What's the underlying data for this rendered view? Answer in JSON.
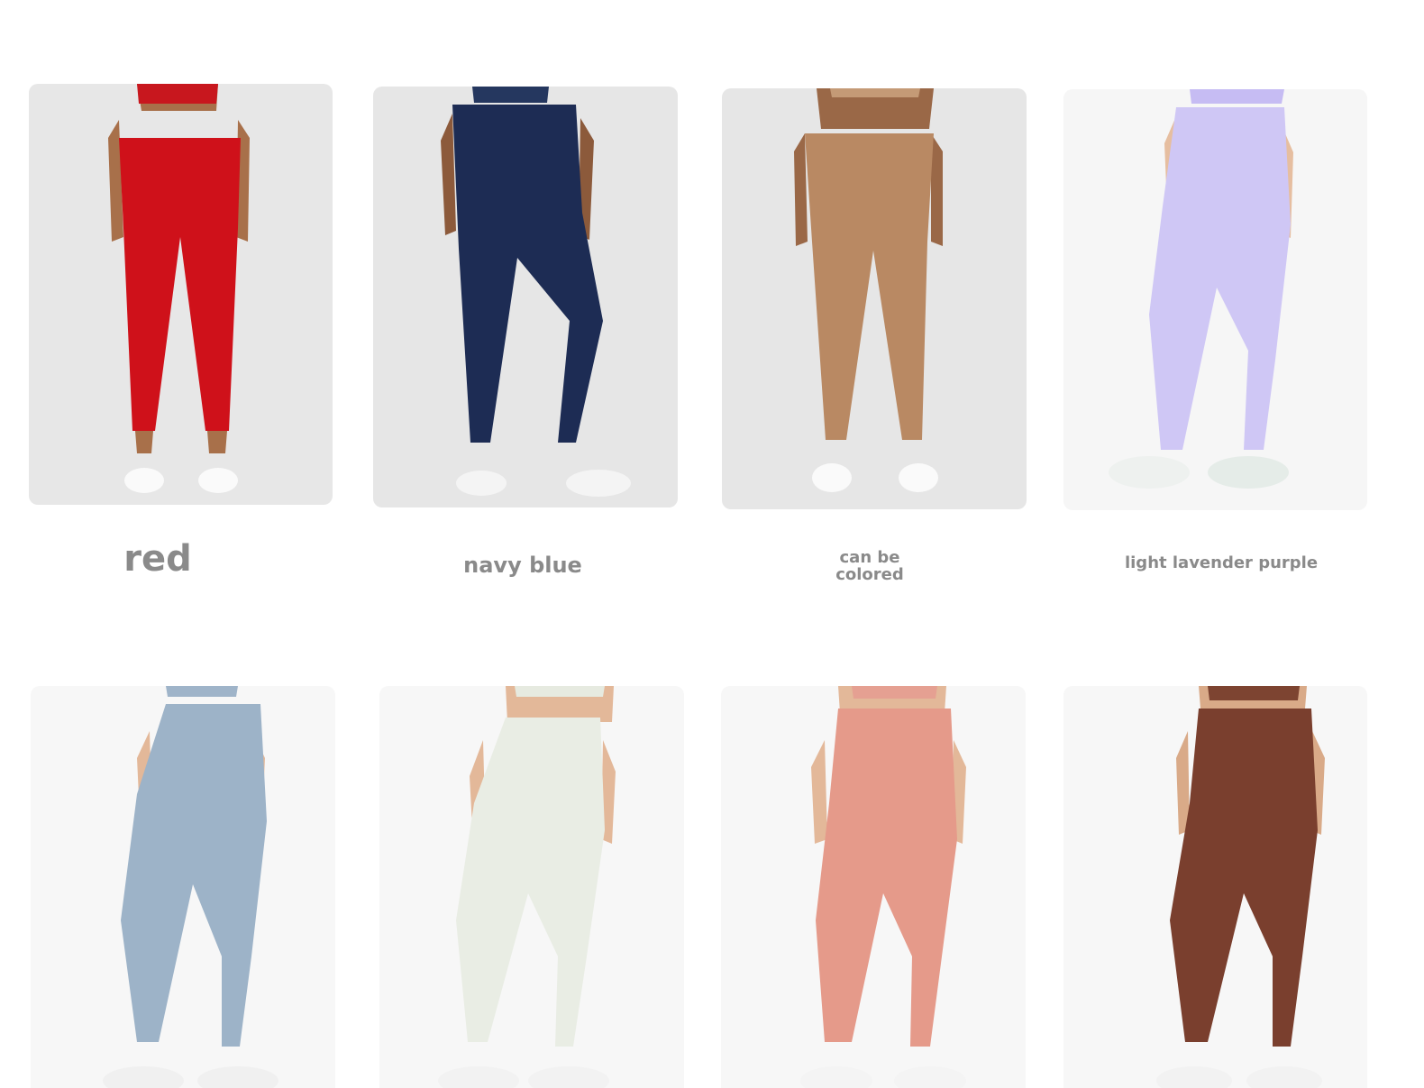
{
  "row1": [
    {
      "label": "red",
      "pants": "#cf111a",
      "top": "#c8171e",
      "bg": "#e7e7e7",
      "skin": "#a8704a",
      "icon": "model-red-leggings"
    },
    {
      "label": "navy blue",
      "pants": "#1d2c54",
      "top": "#25375f",
      "bg": "#e6e6e6",
      "skin": "#8c5a3b",
      "icon": "model-navy-leggings"
    },
    {
      "label": "can be\ncolored",
      "pants": "#b98963",
      "top": "#c49a76",
      "bg": "#e6e6e6",
      "skin": "#9a6847",
      "icon": "model-tan-leggings"
    },
    {
      "label": "light lavender purple",
      "pants": "#cfc7f5",
      "top": "#c6bcf3",
      "bg": "#f6f6f6",
      "skin": "#e6bea0",
      "icon": "model-lavender-leggings"
    }
  ],
  "row2": [
    {
      "pants": "#9db3c8",
      "top": "#9fb4c9",
      "bg": "#f7f7f7",
      "skin": "#e3b899",
      "icon": "model-blue-gray-leggings"
    },
    {
      "pants": "#e9ede4",
      "top": "#e6eae0",
      "bg": "#f7f7f7",
      "skin": "#e3b899",
      "icon": "model-ivory-leggings"
    },
    {
      "pants": "#e59a8a",
      "top": "#e5a092",
      "bg": "#f7f7f7",
      "skin": "#e3b899",
      "icon": "model-pink-leggings"
    },
    {
      "pants": "#7a3f2e",
      "top": "#7d4431",
      "bg": "#f7f7f7",
      "skin": "#d9aa88",
      "icon": "model-brown-leggings"
    }
  ]
}
